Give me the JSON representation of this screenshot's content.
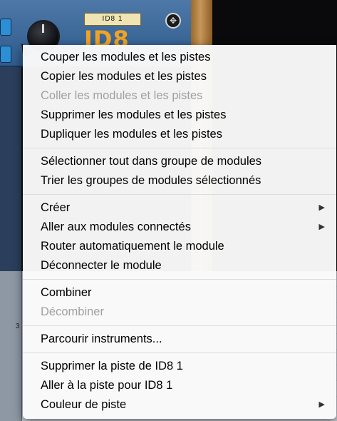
{
  "device": {
    "name_tag": "ID8 1",
    "big_label": "ID8"
  },
  "sequencer": {
    "row_marker": "3"
  },
  "context_menu": {
    "groups": [
      {
        "items": [
          {
            "label": "Couper les modules et les pistes",
            "enabled": true
          },
          {
            "label": "Copier les modules et les pistes",
            "enabled": true
          },
          {
            "label": "Coller les modules et les pistes",
            "enabled": false
          },
          {
            "label": "Supprimer les modules et les pistes",
            "enabled": true
          },
          {
            "label": "Dupliquer les modules et les pistes",
            "enabled": true
          }
        ]
      },
      {
        "items": [
          {
            "label": "Sélectionner tout dans groupe de modules",
            "enabled": true
          },
          {
            "label": "Trier les groupes de modules sélectionnés",
            "enabled": true
          }
        ]
      },
      {
        "items": [
          {
            "label": "Créer",
            "enabled": true,
            "submenu": true
          },
          {
            "label": "Aller aux modules connectés",
            "enabled": true,
            "submenu": true
          },
          {
            "label": "Router automatiquement le module",
            "enabled": true
          },
          {
            "label": "Déconnecter le module",
            "enabled": true
          }
        ]
      },
      {
        "items": [
          {
            "label": "Combiner",
            "enabled": true
          },
          {
            "label": "Décombiner",
            "enabled": false
          }
        ]
      },
      {
        "items": [
          {
            "label": "Parcourir instruments...",
            "enabled": true
          }
        ]
      },
      {
        "items": [
          {
            "label": "Supprimer la piste de ID8 1",
            "enabled": true
          },
          {
            "label": "Aller à la piste pour ID8 1",
            "enabled": true
          },
          {
            "label": "Couleur de piste",
            "enabled": true,
            "submenu": true
          }
        ]
      }
    ],
    "submenu_arrow": "▶"
  }
}
